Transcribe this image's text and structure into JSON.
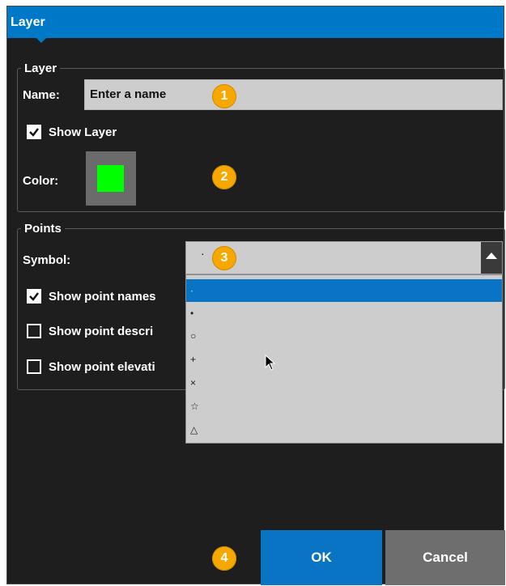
{
  "dialog": {
    "title": "Layer"
  },
  "layer_group": {
    "legend": "Layer",
    "name_label": "Name:",
    "name_placeholder": "Enter a name",
    "show_layer_label": "Show Layer",
    "show_layer_checked": true,
    "color_label": "Color:",
    "color_value": "#00ff00"
  },
  "points_group": {
    "legend": "Points",
    "symbol_label": "Symbol:",
    "symbol_value": "·",
    "show_names_label": "Show point names",
    "show_names_checked": true,
    "show_desc_label": "Show point descri",
    "show_desc_checked": false,
    "show_elev_label": "Show point elevati",
    "show_elev_checked": false
  },
  "symbol_options": [
    "·",
    "•",
    "○",
    "+",
    "×",
    "☆",
    "△"
  ],
  "badges": [
    "1",
    "2",
    "3",
    "4"
  ],
  "buttons": {
    "ok": "OK",
    "cancel": "Cancel"
  },
  "colors": {
    "accent": "#0078c8",
    "badge": "#f6a800",
    "background": "#1e1e1e"
  }
}
